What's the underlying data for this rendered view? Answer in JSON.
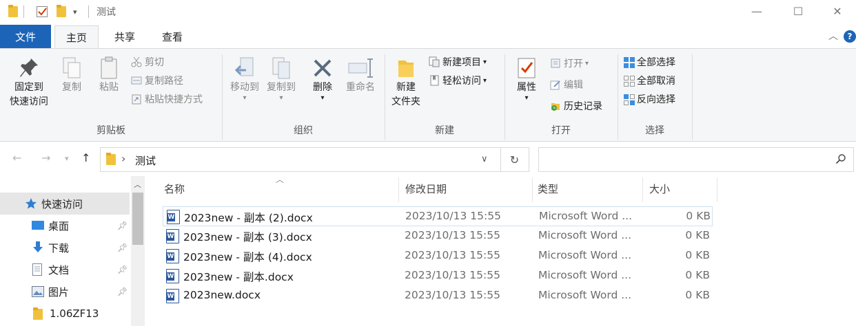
{
  "window": {
    "title": "测试",
    "controls": {
      "minimize": "—",
      "maximize": "☐",
      "close": "✕"
    }
  },
  "tabs": {
    "file": "文件",
    "home": "主页",
    "share": "共享",
    "view": "查看"
  },
  "ribbon": {
    "clipboard": {
      "label": "剪贴板",
      "pin_line1": "固定到",
      "pin_line2": "快速访问",
      "copy": "复制",
      "paste": "粘贴",
      "cut": "剪切",
      "copy_path": "复制路径",
      "paste_shortcut": "粘贴快捷方式"
    },
    "organize": {
      "label": "组织",
      "move_to": "移动到",
      "copy_to": "复制到",
      "delete": "删除",
      "rename": "重命名"
    },
    "new": {
      "label": "新建",
      "new_folder_line1": "新建",
      "new_folder_line2": "文件夹",
      "new_item": "新建项目",
      "easy_access": "轻松访问"
    },
    "open": {
      "label": "打开",
      "properties": "属性",
      "open": "打开",
      "edit": "编辑",
      "history": "历史记录"
    },
    "select": {
      "label": "选择",
      "select_all": "全部选择",
      "select_none": "全部取消",
      "invert": "反向选择"
    }
  },
  "address": {
    "crumb_separator": "›",
    "folder": "测试"
  },
  "navpane": {
    "items": [
      {
        "label": "快速访问"
      },
      {
        "label": "桌面"
      },
      {
        "label": "下载"
      },
      {
        "label": "文档"
      },
      {
        "label": "图片"
      },
      {
        "label": "1.06ZF13"
      }
    ]
  },
  "columns": {
    "name": "名称",
    "date": "修改日期",
    "type": "类型",
    "size": "大小"
  },
  "files": [
    {
      "name": "2023new - 副本 (2).docx",
      "date": "2023/10/13 15:55",
      "type": "Microsoft Word ...",
      "size": "0 KB"
    },
    {
      "name": "2023new - 副本 (3).docx",
      "date": "2023/10/13 15:55",
      "type": "Microsoft Word ...",
      "size": "0 KB"
    },
    {
      "name": "2023new - 副本 (4).docx",
      "date": "2023/10/13 15:55",
      "type": "Microsoft Word ...",
      "size": "0 KB"
    },
    {
      "name": "2023new - 副本.docx",
      "date": "2023/10/13 15:55",
      "type": "Microsoft Word ...",
      "size": "0 KB"
    },
    {
      "name": "2023new.docx",
      "date": "2023/10/13 15:55",
      "type": "Microsoft Word ...",
      "size": "0 KB"
    }
  ],
  "colors": {
    "accent": "#1c64b8",
    "folder": "#f0c23c",
    "word": "#2b579a",
    "ribbon_bg": "#f5f6f7"
  }
}
